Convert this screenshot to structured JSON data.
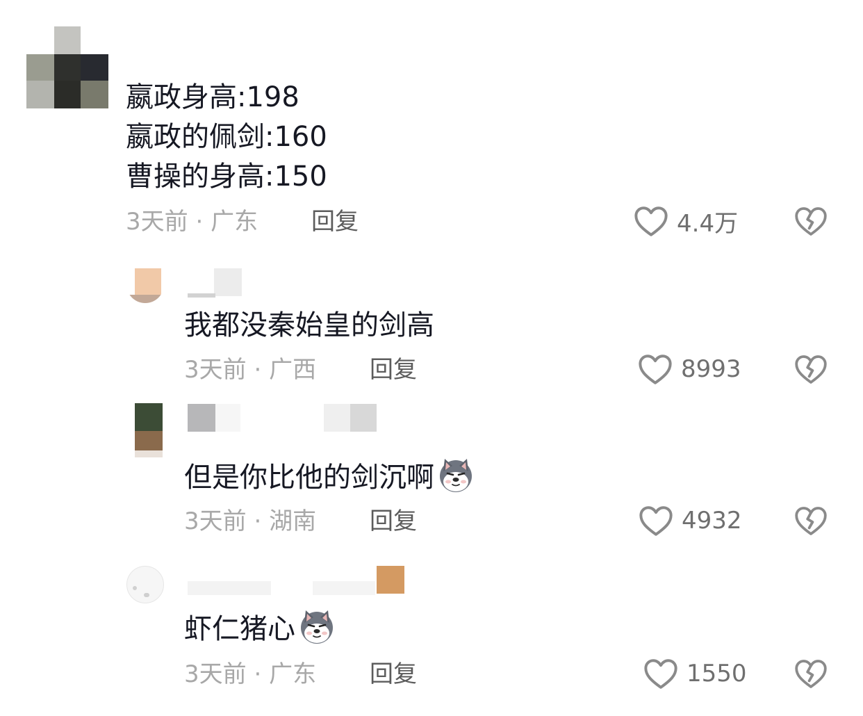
{
  "comments": [
    {
      "lines": [
        "嬴政身高:198",
        "嬴政的佩剑:160",
        "曹操的身高:150"
      ],
      "time": "3天前",
      "location": "广东",
      "reply_label": "回复",
      "likes": "4.4万",
      "emoji": ""
    },
    {
      "lines": [
        "我都没秦始皇的剑高"
      ],
      "time": "3天前",
      "location": "广西",
      "reply_label": "回复",
      "likes": "8993",
      "emoji": ""
    },
    {
      "lines": [
        "但是你比他的剑沉啊"
      ],
      "time": "3天前",
      "location": "湖南",
      "reply_label": "回复",
      "likes": "4932",
      "emoji": "husky-emoji"
    },
    {
      "lines": [
        "虾仁猪心"
      ],
      "time": "3天前",
      "location": "广东",
      "reply_label": "回复",
      "likes": "1550",
      "emoji": "husky-emoji"
    }
  ],
  "icons": {
    "like": "heart-outline-icon",
    "dislike": "broken-heart-icon"
  },
  "colors": {
    "text": "#161823",
    "meta": "#a8a8a8",
    "reply": "#5c5c5c",
    "icon": "#8a8a8a"
  }
}
